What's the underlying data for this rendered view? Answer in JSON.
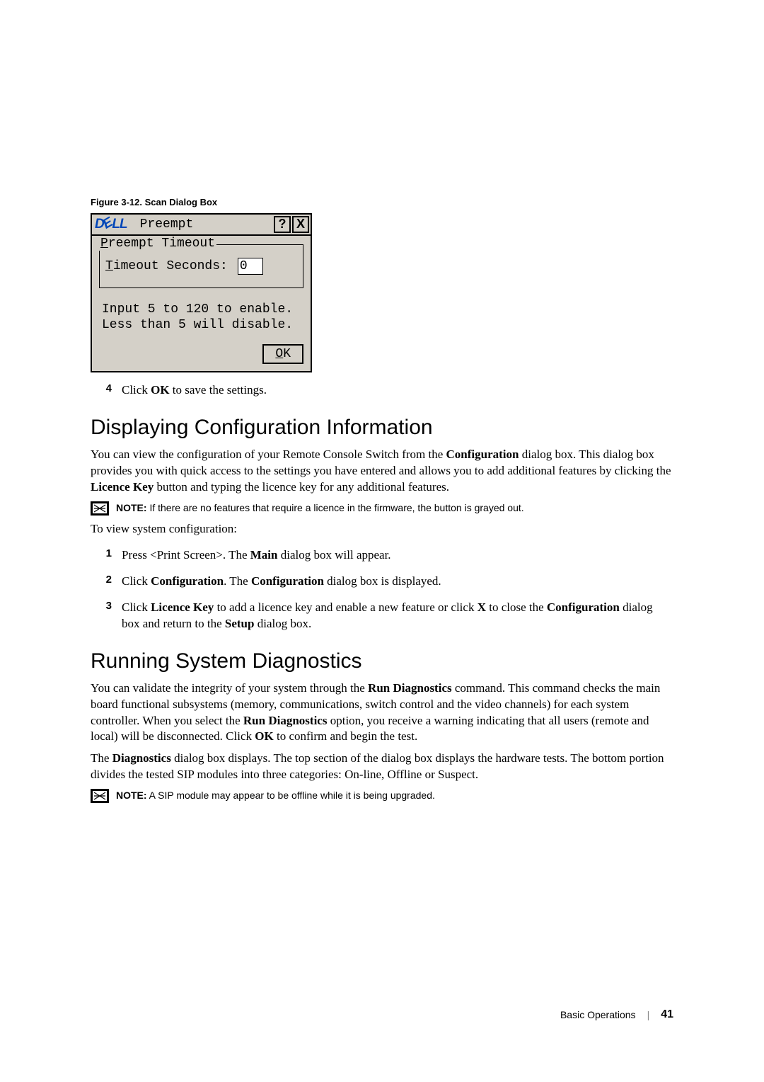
{
  "figure_caption": "Figure 3-12.    Scan Dialog Box",
  "dialog": {
    "logo": "DELL",
    "title": "Preempt",
    "help_btn": "?",
    "close_btn": "X",
    "group_label_pre": "P",
    "group_label_rest": "reempt Timeout",
    "timeout_label_pre": "T",
    "timeout_label_rest": "imeout Seconds:",
    "timeout_value": "0",
    "hint_line1": "Input 5 to 120 to enable.",
    "hint_line2": "Less than 5 will disable.",
    "ok_pre": "O",
    "ok_rest": "K"
  },
  "step4_num": "4",
  "step4_text_pre": "Click ",
  "step4_ok": "OK",
  "step4_text_post": " to save the settings.",
  "heading1": "Displaying Configuration Information",
  "para1_pre": "You can view the configuration of your Remote Console Switch from the ",
  "para1_b1": "Configuration",
  "para1_mid": " dialog box. This dialog box provides you with quick access to the settings you have entered and allows you to add additional features by clicking the ",
  "para1_b2": "Licence Key",
  "para1_post": " button and typing the licence key for any additional features.",
  "note1_label": "NOTE:",
  "note1_text": " If there are no features that require a licence in the firmware, the button is grayed out.",
  "para2": "To view system configuration:",
  "s1_num": "1",
  "s1_pre": "Press <Print Screen>. The ",
  "s1_b": "Main",
  "s1_post": " dialog box will appear.",
  "s2_num": "2",
  "s2_pre": "Click ",
  "s2_b1": "Configuration",
  "s2_mid": ". The ",
  "s2_b2": "Configuration",
  "s2_post": " dialog box is displayed.",
  "s3_num": "3",
  "s3_pre": "Click ",
  "s3_b1": "Licence Key",
  "s3_mid1": " to add a licence key and enable a new feature or click ",
  "s3_b2": "X",
  "s3_mid2": " to close the ",
  "s3_b3": "Configuration",
  "s3_mid3": " dialog box and return to the ",
  "s3_b4": "Setup",
  "s3_post": " dialog box.",
  "heading2": "Running System Diagnostics",
  "para3_pre": "You can validate the integrity of your system through the ",
  "para3_b1": "Run Diagnostics",
  "para3_mid1": " command. This command checks the main board functional subsystems (memory, communications, switch control and the video channels) for each system controller. When you select the ",
  "para3_b2": "Run Diagnostics",
  "para3_mid2": " option, you receive a warning indicating that all users (remote and local) will be disconnected. Click ",
  "para3_b3": "OK",
  "para3_post": " to confirm and begin the test.",
  "para4_pre": "The ",
  "para4_b1": "Diagnostics",
  "para4_post": " dialog box displays. The top section of the dialog box displays the hardware tests. The bottom portion divides the tested SIP modules into three categories: On-line, Offline or Suspect.",
  "note2_label": "NOTE:",
  "note2_text": " A SIP module may appear to be offline while it is being upgraded.",
  "footer_section": "Basic Operations",
  "footer_page": "41"
}
